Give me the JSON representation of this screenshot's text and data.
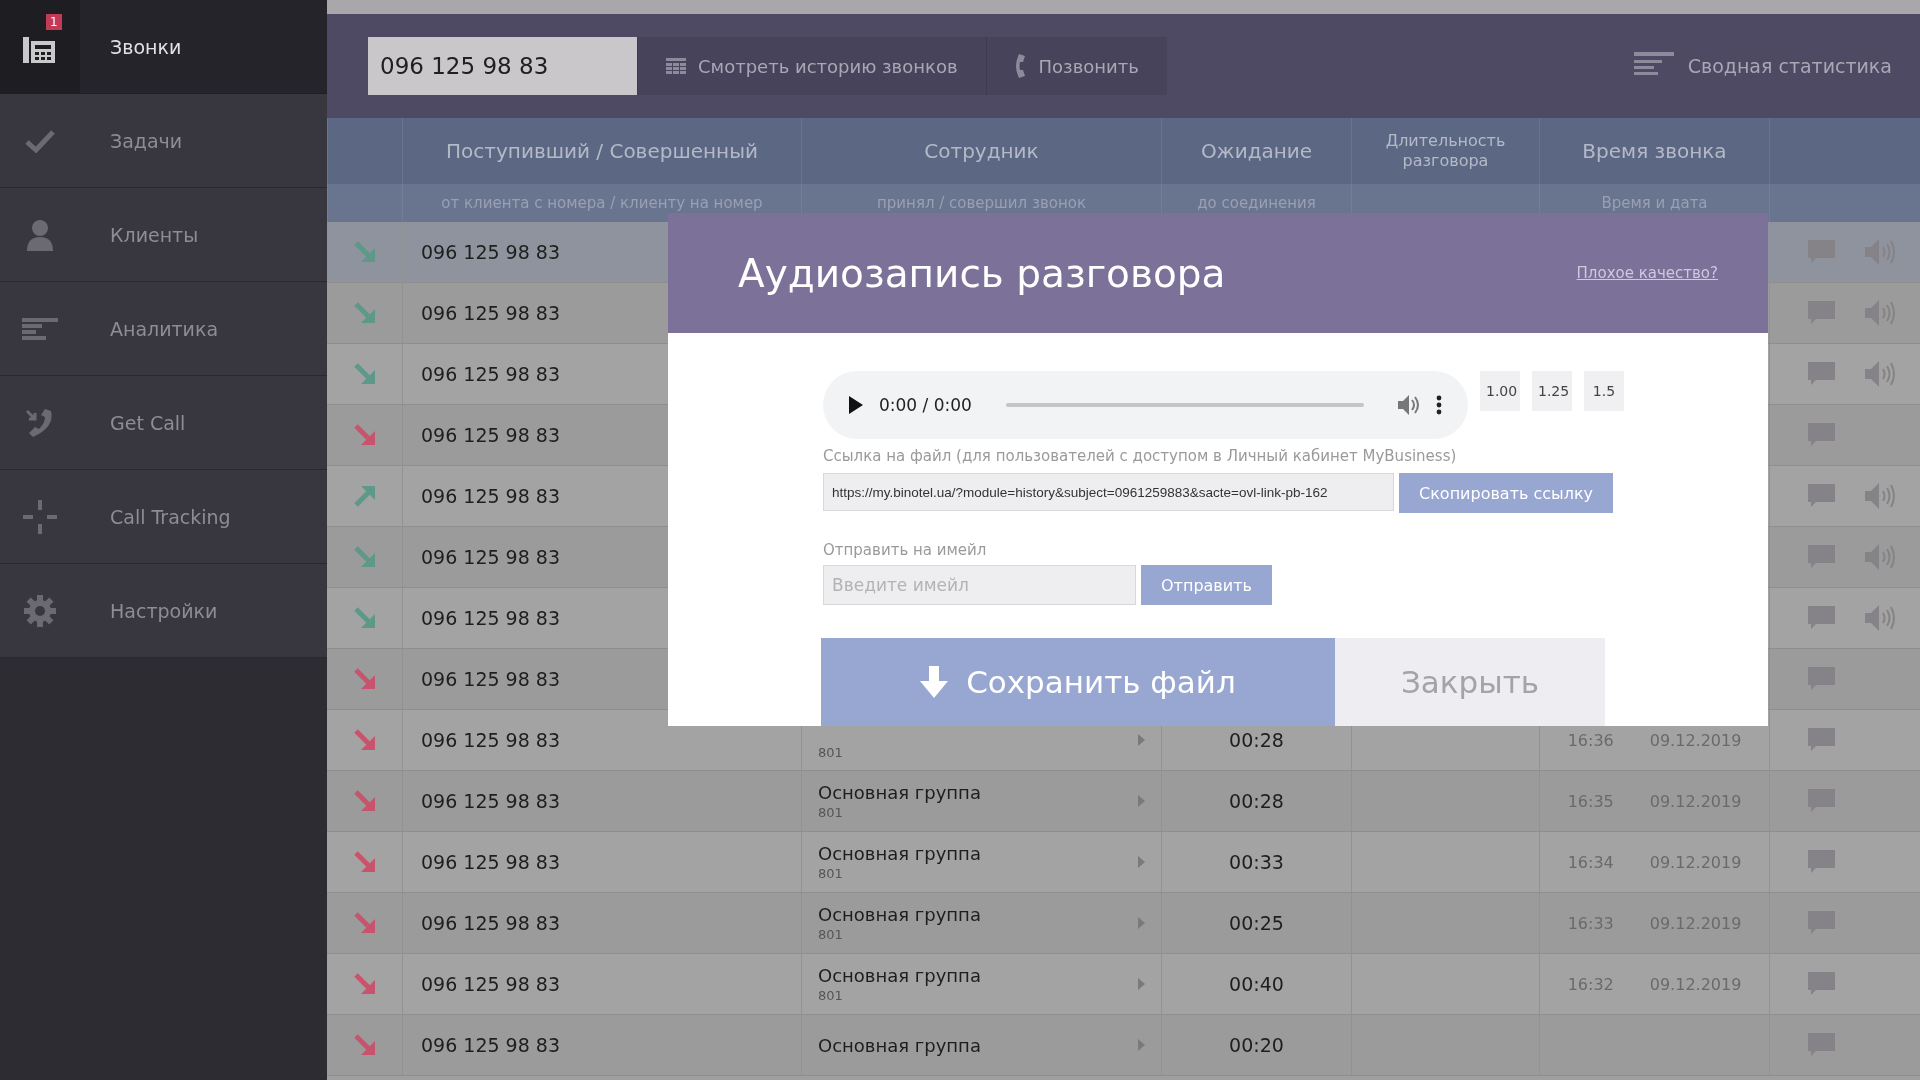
{
  "sidebar": {
    "items": [
      {
        "label": "Звонки",
        "selected": true,
        "badge": "1"
      },
      {
        "label": "Задачи",
        "selected": false
      },
      {
        "label": "Клиенты",
        "selected": false
      },
      {
        "label": "Аналитика",
        "selected": false
      },
      {
        "label": "Get Call",
        "selected": false
      },
      {
        "label": "Call Tracking",
        "selected": false
      },
      {
        "label": "Настройки",
        "selected": false
      }
    ]
  },
  "toolbar": {
    "search_value": "096 125 98 83",
    "history_button": "Смотреть историю звонков",
    "call_button": "Позвонить",
    "stats_link": "Сводная статистика"
  },
  "table": {
    "columns": [
      {
        "title": "Поступивший / Совершенный",
        "subtitle": "от клиента с номера / клиенту на номер"
      },
      {
        "title": "Сотрудник",
        "subtitle": "принял / совершил звонок"
      },
      {
        "title": "Ожидание",
        "subtitle": "до соединения"
      },
      {
        "title": "Длительность разговора"
      },
      {
        "title": "Время звонка",
        "subtitle": "Время и дата"
      }
    ],
    "rows": [
      {
        "selected": true,
        "outgoing": false,
        "missed": false,
        "phone": "096 125 98 83",
        "recording": true
      },
      {
        "selected": false,
        "outgoing": false,
        "missed": false,
        "phone": "096 125 98 83",
        "recording": true
      },
      {
        "selected": false,
        "outgoing": false,
        "missed": false,
        "phone": "096 125 98 83",
        "recording": true
      },
      {
        "selected": false,
        "outgoing": false,
        "missed": true,
        "phone": "096 125 98 83",
        "recording": false
      },
      {
        "selected": false,
        "outgoing": true,
        "missed": false,
        "phone": "096 125 98 83",
        "recording": true
      },
      {
        "selected": false,
        "outgoing": false,
        "missed": false,
        "phone": "096 125 98 83",
        "recording": true
      },
      {
        "selected": false,
        "outgoing": false,
        "missed": false,
        "phone": "096 125 98 83",
        "recording": true
      },
      {
        "selected": false,
        "outgoing": false,
        "missed": true,
        "phone": "096 125 98 83",
        "recording": false
      },
      {
        "selected": false,
        "outgoing": false,
        "missed": true,
        "phone": "096 125 98 83",
        "extension": "801",
        "wait": "00:28",
        "time": "16:36",
        "date": "09.12.2019",
        "recording": false
      },
      {
        "selected": false,
        "outgoing": false,
        "missed": true,
        "phone": "096 125 98 83",
        "employee": "Основная группа",
        "extension": "801",
        "wait": "00:28",
        "time": "16:35",
        "date": "09.12.2019",
        "recording": false
      },
      {
        "selected": false,
        "outgoing": false,
        "missed": true,
        "phone": "096 125 98 83",
        "employee": "Основная группа",
        "extension": "801",
        "wait": "00:33",
        "time": "16:34",
        "date": "09.12.2019",
        "recording": false
      },
      {
        "selected": false,
        "outgoing": false,
        "missed": true,
        "phone": "096 125 98 83",
        "employee": "Основная группа",
        "extension": "801",
        "wait": "00:25",
        "time": "16:33",
        "date": "09.12.2019",
        "recording": false
      },
      {
        "selected": false,
        "outgoing": false,
        "missed": true,
        "phone": "096 125 98 83",
        "employee": "Основная группа",
        "extension": "801",
        "wait": "00:40",
        "time": "16:32",
        "date": "09.12.2019",
        "recording": false
      },
      {
        "selected": false,
        "outgoing": false,
        "missed": true,
        "phone": "096 125 98 83",
        "employee": "Основная группа",
        "wait": "00:20",
        "recording": false
      }
    ]
  },
  "modal": {
    "title": "Аудиозапись разговора",
    "quality_link": "Плохое качество?",
    "player_time": "0:00 / 0:00",
    "speeds": [
      "1.00",
      "1.25",
      "1.5"
    ],
    "link_label": "Ссылка на файл (для пользователей с доступом в Личный кабинет MyBusiness)",
    "link_value": "https://my.binotel.ua/?module=history&subject=0961259883&sacte=ovl-link-pb-162",
    "copy_button": "Скопировать ссылку",
    "email_label": "Отправить на имейл",
    "email_placeholder": "Введите имейл",
    "send_button": "Отправить",
    "save_button": "Сохранить файл",
    "close_button": "Закрыть"
  }
}
